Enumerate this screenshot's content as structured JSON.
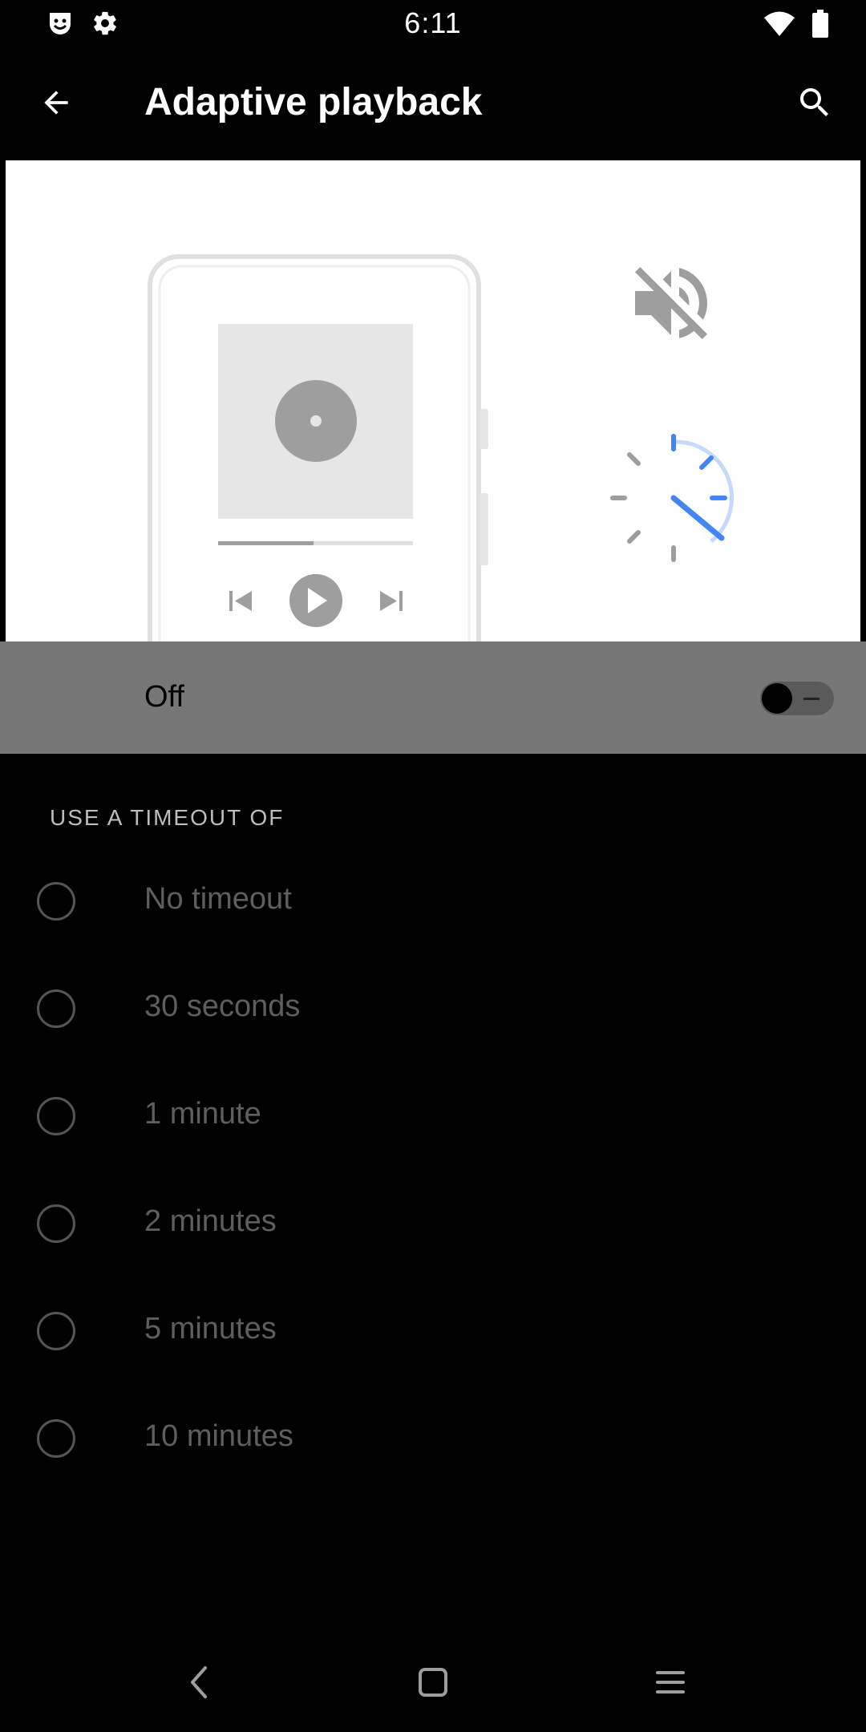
{
  "status_bar": {
    "time": "6:11",
    "icons_left": [
      "smiley-notification-icon",
      "gear-icon"
    ],
    "icons_right": [
      "wifi-icon",
      "battery-icon"
    ]
  },
  "app_bar": {
    "title": "Adaptive playback",
    "back_icon": "arrow-left-icon",
    "search_icon": "search-icon"
  },
  "illustration": {
    "icons": [
      "volume-off-icon",
      "timer-icon",
      "album-icon",
      "previous-icon",
      "play-icon",
      "next-icon"
    ],
    "progress_fraction": 0.49,
    "accent_color": "#4285f4"
  },
  "main_toggle": {
    "label": "Off",
    "checked": false
  },
  "section": {
    "header": "USE A TIMEOUT OF"
  },
  "options": [
    {
      "label": "No timeout",
      "selected": false
    },
    {
      "label": "30 seconds",
      "selected": false
    },
    {
      "label": "1 minute",
      "selected": false
    },
    {
      "label": "2 minutes",
      "selected": false
    },
    {
      "label": "5 minutes",
      "selected": false
    },
    {
      "label": "10 minutes",
      "selected": false
    }
  ],
  "nav_bar": {
    "icons": [
      "nav-back-icon",
      "nav-home-icon",
      "nav-recents-icon"
    ]
  },
  "colors": {
    "background": "#000000",
    "toggle_row_background": "#777777",
    "disabled_text": "#5e5e5e"
  }
}
